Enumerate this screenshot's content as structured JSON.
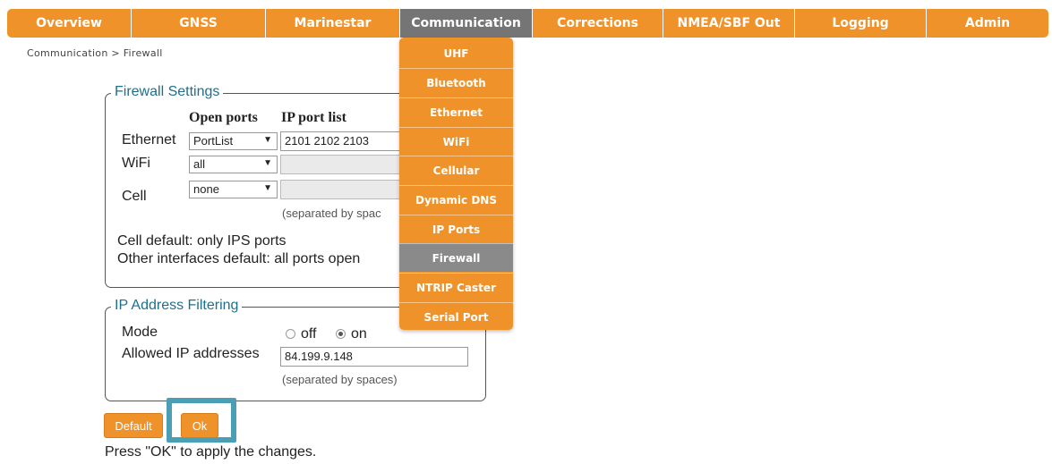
{
  "nav": {
    "items": [
      "Overview",
      "GNSS",
      "Marinestar",
      "Communication",
      "Corrections",
      "NMEA/SBF Out",
      "Logging",
      "Admin"
    ],
    "active": "Communication"
  },
  "breadcrumb": "Communication > Firewall",
  "dropdown": {
    "items": [
      "UHF",
      "Bluetooth",
      "Ethernet",
      "WiFi",
      "Cellular",
      "Dynamic DNS",
      "IP Ports",
      "Firewall",
      "NTRIP Caster",
      "Serial Port"
    ],
    "active": "Firewall"
  },
  "firewall": {
    "legend": "Firewall Settings",
    "col_open_ports": "Open ports",
    "col_ip_port_list": "IP port list",
    "rows": [
      {
        "label": "Ethernet",
        "select": "PortList",
        "ports": "2101 2102 2103"
      },
      {
        "label": "WiFi",
        "select": "all",
        "ports": ""
      },
      {
        "label": "Cell",
        "select": "none",
        "ports": ""
      }
    ],
    "hint": "(separated by spac",
    "note1": "Cell default: only IPS ports",
    "note2": "Other interfaces default: all ports open"
  },
  "ipfilter": {
    "legend": "IP Address Filtering",
    "mode_label": "Mode",
    "mode_off": "off",
    "mode_on": "on",
    "mode_selected": "on",
    "allowed_label": "Allowed IP addresses",
    "allowed_value": "84.199.9.148",
    "hint": "(separated by spaces)"
  },
  "buttons": {
    "default": "Default",
    "ok": "Ok"
  },
  "footer_note": "Press \"OK\" to apply the changes.",
  "colors": {
    "accent": "#f0922a",
    "active": "#757575",
    "legend": "#1f6f8b",
    "highlight": "#4a9fb5"
  }
}
